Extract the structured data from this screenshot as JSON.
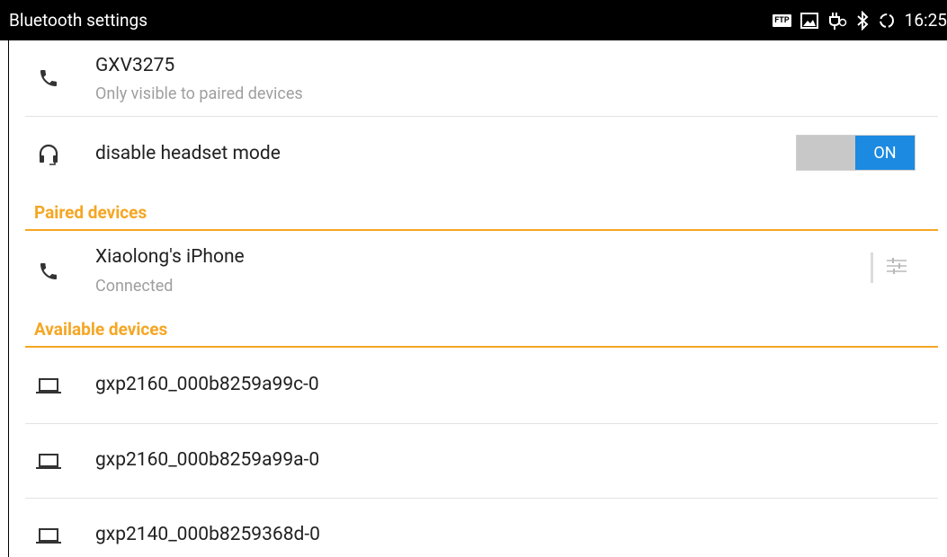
{
  "status_bar": {
    "title": "Bluetooth settings",
    "ftp_label": "FTP",
    "time": "16:25",
    "icons": [
      "ftp-icon",
      "image-icon",
      "usb-debug-icon",
      "bluetooth-icon",
      "sync-icon"
    ]
  },
  "device": {
    "name": "GXV3275",
    "visibility": "Only visible to paired devices",
    "icon": "phone-icon"
  },
  "headset": {
    "label": "disable headset mode",
    "toggle_state": "ON",
    "icon": "headset-icon"
  },
  "paired": {
    "header": "Paired devices",
    "items": [
      {
        "name": "Xiaolong's iPhone",
        "status": "Connected",
        "icon": "phone-icon"
      }
    ]
  },
  "available": {
    "header": "Available devices",
    "items": [
      {
        "name": "gxp2160_000b8259a99c-0",
        "icon": "laptop-icon"
      },
      {
        "name": "gxp2160_000b8259a99a-0",
        "icon": "laptop-icon"
      },
      {
        "name": "gxp2140_000b8259368d-0",
        "icon": "laptop-icon"
      }
    ]
  },
  "colors": {
    "accent": "#f5a623",
    "toggle_on": "#1c8ae0",
    "toggle_off": "#c8c8c8"
  }
}
